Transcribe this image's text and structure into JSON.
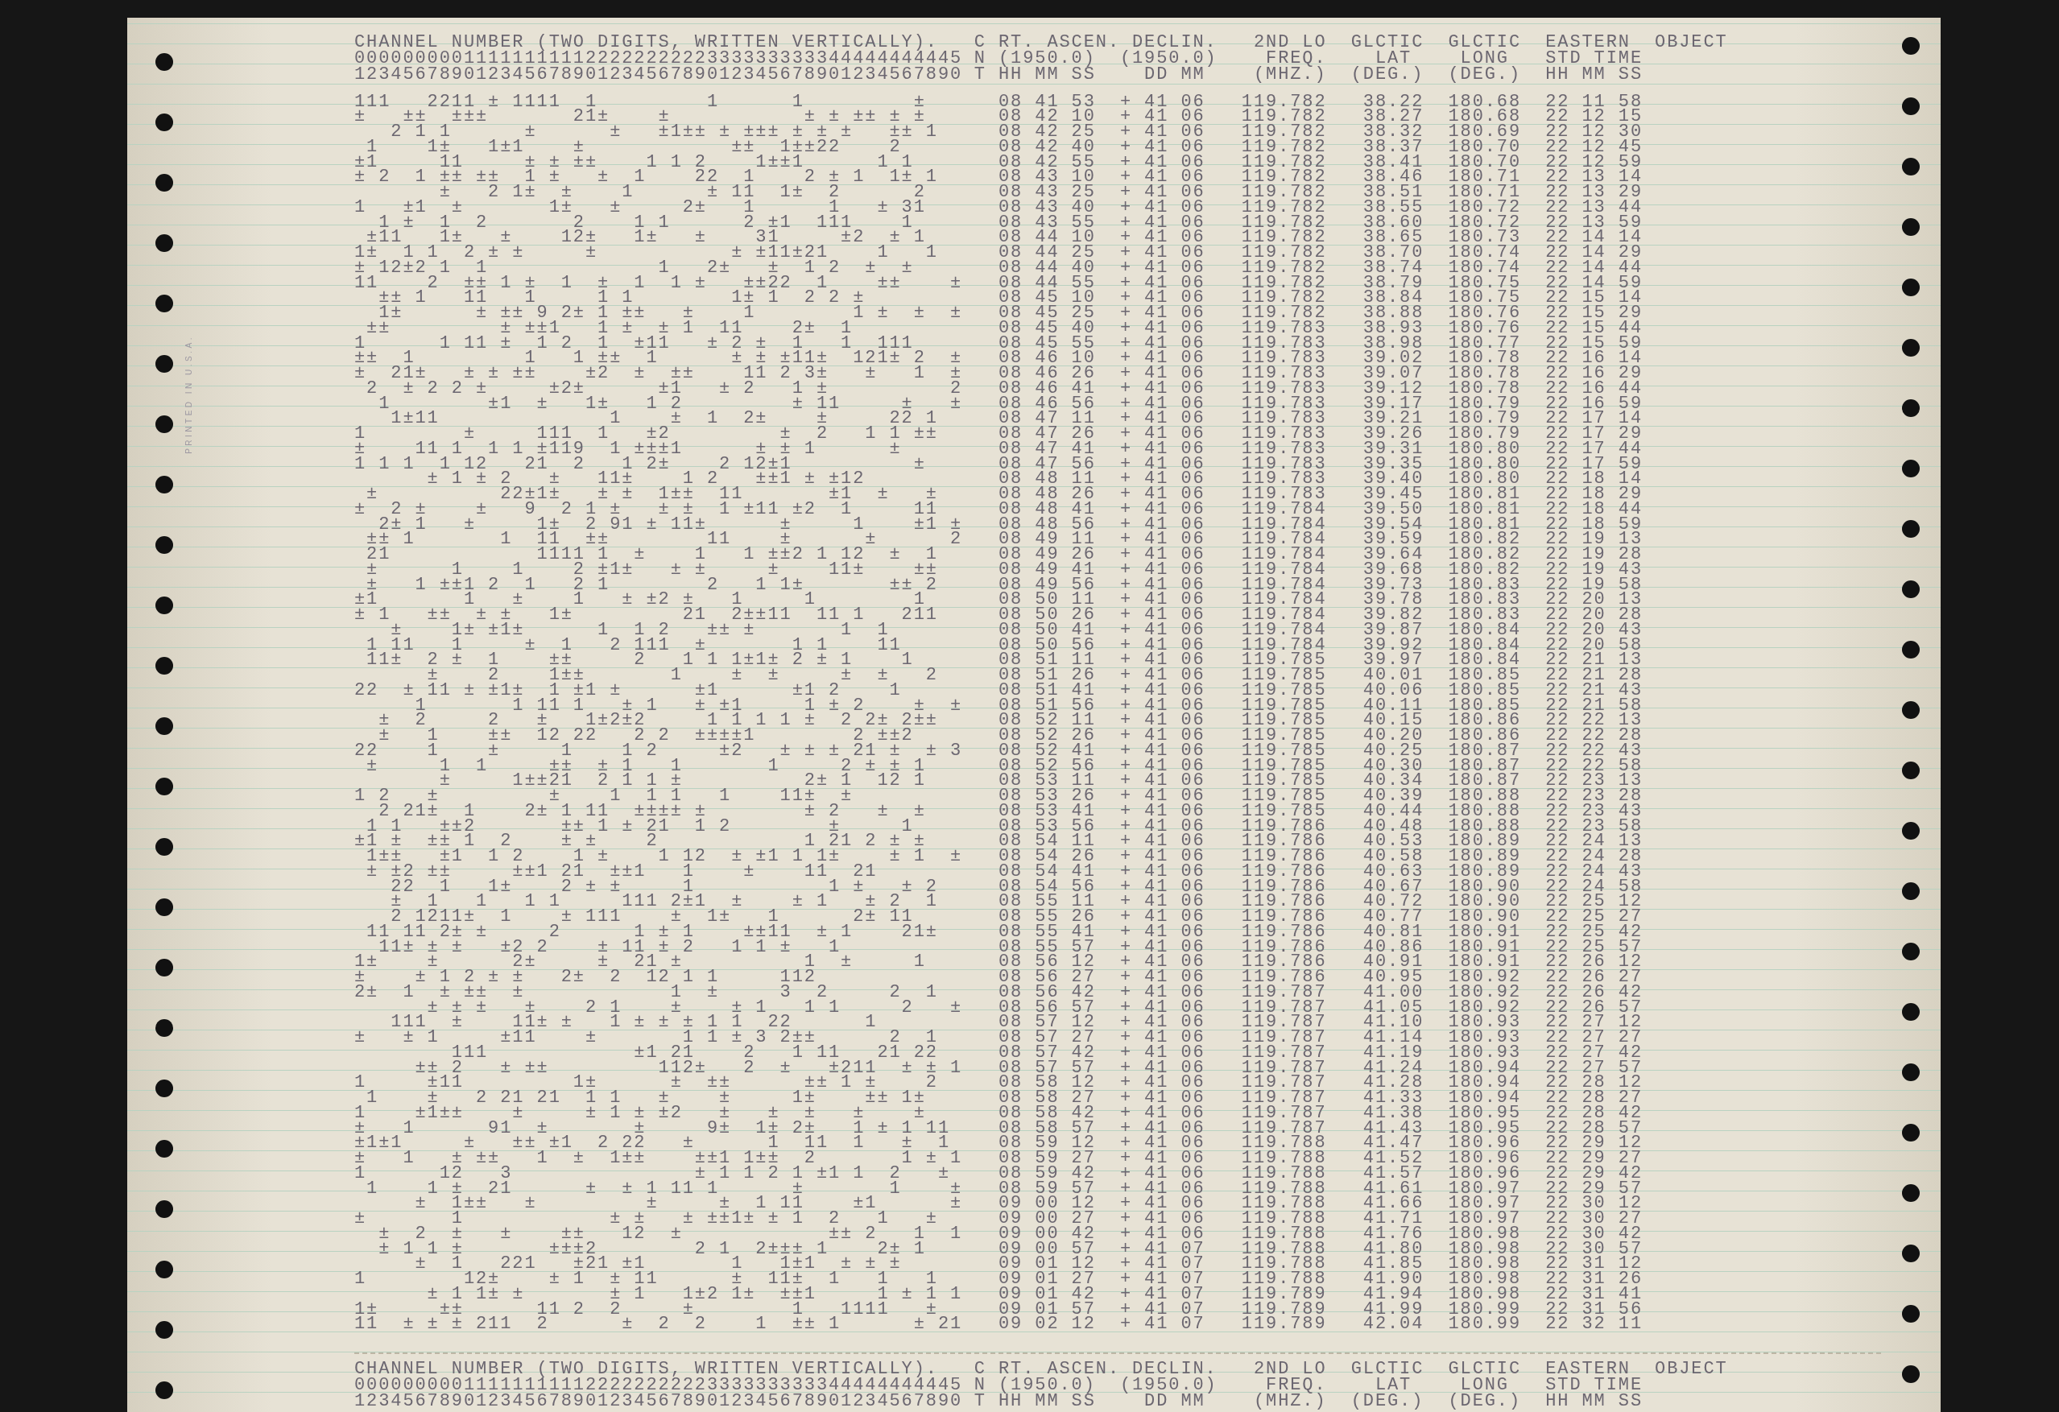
{
  "printout": {
    "margin_imprint": "PRINTED IN U.S.A.",
    "header": {
      "channels": [
        "CHANNEL NUMBER (TWO DIGITS, WRITTEN VERTICALLY).",
        "00000000011111111112222222222333333333344444444445",
        "12345678901234567890123456789012345678901234567890"
      ],
      "flag": [
        "C",
        "N",
        "T"
      ],
      "right_ascension": [
        "RT. ASCEN.",
        "(1950.0)",
        "HH MM SS"
      ],
      "declination": [
        "DECLIN.",
        "(1950.0)",
        "DD MM"
      ],
      "frequency": [
        "2ND LO",
        "FREQ.",
        "(MHZ.)"
      ],
      "galactic_lat": [
        "GLCTIC",
        "LAT",
        "(DEG.)"
      ],
      "galactic_long": [
        "GLCTIC",
        "LONG",
        "(DEG.)"
      ],
      "time": [
        "EASTERN",
        "STD TIME",
        "HH MM SS"
      ],
      "object": [
        "OBJECT"
      ]
    },
    "rows": [
      {
        "channels": "111   2211 ± 1111  1         1      1         ±",
        "right_ascension": "08 41 53",
        "declination": "+ 41 06",
        "frequency": "119.782",
        "galactic_lat": "38.22",
        "galactic_long": "180.68",
        "time": "22 11 58"
      },
      {
        "channels": "±   ±±  ±±±       21±    ±           ± ± ±± ± ±",
        "right_ascension": "08 42 10",
        "declination": "+ 41 06",
        "frequency": "119.782",
        "galactic_lat": "38.27",
        "galactic_long": "180.68",
        "time": "22 12 15"
      },
      {
        "channels": "   2 1 1      ±      ±   ±1±± ± ±±± ± ± ±   ±± 1",
        "right_ascension": "08 42 25",
        "declination": "+ 41 06",
        "frequency": "119.782",
        "galactic_lat": "38.32",
        "galactic_long": "180.69",
        "time": "22 12 30"
      },
      {
        "channels": " 1    1±   1±1    ±            ±±  1±±22    2",
        "right_ascension": "08 42 40",
        "declination": "+ 41 06",
        "frequency": "119.782",
        "galactic_lat": "38.37",
        "galactic_long": "180.70",
        "time": "22 12 45"
      },
      {
        "channels": "±1     11     ± ± ±±    1 1 2    1±±1      1 1",
        "right_ascension": "08 42 55",
        "declination": "+ 41 06",
        "frequency": "119.782",
        "galactic_lat": "38.41",
        "galactic_long": "180.70",
        "time": "22 12 59"
      },
      {
        "channels": "± 2  1 ±± ±±  1 ±   ±  1    22  1    2 ± 1  1± 1",
        "right_ascension": "08 43 10",
        "declination": "+ 41 06",
        "frequency": "119.782",
        "galactic_lat": "38.46",
        "galactic_long": "180.71",
        "time": "22 13 14"
      },
      {
        "channels": "       ±   2 1±  ±    1      ± 11  1±  2      2",
        "right_ascension": "08 43 25",
        "declination": "+ 41 06",
        "frequency": "119.782",
        "galactic_lat": "38.51",
        "galactic_long": "180.71",
        "time": "22 13 29"
      },
      {
        "channels": "1   ±1  ±       1±   ±     2±   1      1   ± 31",
        "right_ascension": "08 43 40",
        "declination": "+ 41 06",
        "frequency": "119.782",
        "galactic_lat": "38.55",
        "galactic_long": "180.72",
        "time": "22 13 44"
      },
      {
        "channels": "  1 ±  1  2       2    1 1      2 ±1  111    1",
        "right_ascension": "08 43 55",
        "declination": "+ 41 06",
        "frequency": "119.782",
        "galactic_lat": "38.60",
        "galactic_long": "180.72",
        "time": "22 13 59"
      },
      {
        "channels": " ±11   1±   ±    12±   1±   ±    31     ±2  ± 1",
        "right_ascension": "08 44 10",
        "declination": "+ 41 06",
        "frequency": "119.782",
        "galactic_lat": "38.65",
        "galactic_long": "180.73",
        "time": "22 14 14"
      },
      {
        "channels": "1±  1 1  2 ± ±     ±           ± ±11±21    1   1",
        "right_ascension": "08 44 25",
        "declination": "+ 41 06",
        "frequency": "119.782",
        "galactic_lat": "38.70",
        "galactic_long": "180.74",
        "time": "22 14 29"
      },
      {
        "channels": "± 12±2 1  1              1   2±   ±  1 2  ±  ±",
        "right_ascension": "08 44 40",
        "declination": "+ 41 06",
        "frequency": "119.782",
        "galactic_lat": "38.74",
        "galactic_long": "180.74",
        "time": "22 14 44"
      },
      {
        "channels": "11    2  ±± 1 ±  1  ±  1  1 ±   ±±22  1    ±±    ±",
        "right_ascension": "08 44 55",
        "declination": "+ 41 06",
        "frequency": "119.782",
        "galactic_lat": "38.79",
        "galactic_long": "180.75",
        "time": "22 14 59"
      },
      {
        "channels": "  ±± 1   11   1     1 1        1± 1  2 2 ±",
        "right_ascension": "08 45 10",
        "declination": "+ 41 06",
        "frequency": "119.782",
        "galactic_lat": "38.84",
        "galactic_long": "180.75",
        "time": "22 15 14"
      },
      {
        "channels": "  1±      ± ±± 9 2± 1 ±±   ±    1        1 ±  ±  ±",
        "right_ascension": "08 45 25",
        "declination": "+ 41 06",
        "frequency": "119.782",
        "galactic_lat": "38.88",
        "galactic_long": "180.76",
        "time": "22 15 29"
      },
      {
        "channels": " ±±         ± ±±1   1 ±  ± 1  11    2±  1",
        "right_ascension": "08 45 40",
        "declination": "+ 41 06",
        "frequency": "119.783",
        "galactic_lat": "38.93",
        "galactic_long": "180.76",
        "time": "22 15 44"
      },
      {
        "channels": "1      1 11 ±  1 2  1  ±11   ± 2 ±  1   1  111",
        "right_ascension": "08 45 55",
        "declination": "+ 41 06",
        "frequency": "119.783",
        "galactic_lat": "38.98",
        "galactic_long": "180.77",
        "time": "22 15 59"
      },
      {
        "channels": "±±  1         1   1 ±±  1      ± ± ±11±  121± 2  ±",
        "right_ascension": "08 46 10",
        "declination": "+ 41 06",
        "frequency": "119.783",
        "galactic_lat": "39.02",
        "galactic_long": "180.78",
        "time": "22 16 14"
      },
      {
        "channels": "±  21±   ± ± ±±    ±2  ±  ±±    11 2 3±   ±   1  ±",
        "right_ascension": "08 46 26",
        "declination": "+ 41 06",
        "frequency": "119.783",
        "galactic_lat": "39.07",
        "galactic_long": "180.78",
        "time": "22 16 29"
      },
      {
        "channels": " 2  ± 2 2 ±     ±2±      ±1   ± 2   1 ±          2",
        "right_ascension": "08 46 41",
        "declination": "+ 41 06",
        "frequency": "119.783",
        "galactic_lat": "39.12",
        "galactic_long": "180.78",
        "time": "22 16 44"
      },
      {
        "channels": "  1        ±1  ±   1±   1 2         ± 11     ±   ±",
        "right_ascension": "08 46 56",
        "declination": "+ 41 06",
        "frequency": "119.783",
        "galactic_lat": "39.17",
        "galactic_long": "180.79",
        "time": "22 16 59"
      },
      {
        "channels": "   1±11              1    ±  1  2±    ±     22 1",
        "right_ascension": "08 47 11",
        "declination": "+ 41 06",
        "frequency": "119.783",
        "galactic_lat": "39.21",
        "galactic_long": "180.79",
        "time": "22 17 14"
      },
      {
        "channels": "1        ±     111  1   ±2         ±  2   1 1 ±±",
        "right_ascension": "08 47 26",
        "declination": "+ 41 06",
        "frequency": "119.783",
        "galactic_lat": "39.26",
        "galactic_long": "180.79",
        "time": "22 17 29"
      },
      {
        "channels": "±    11 1  1 1 ±119  1 ±±±1      ± ± 1      ±",
        "right_ascension": "08 47 41",
        "declination": "+ 41 06",
        "frequency": "119.783",
        "galactic_lat": "39.31",
        "galactic_long": "180.80",
        "time": "22 17 44"
      },
      {
        "channels": "1 1 1  1 12   21  2   1 2±    2 12±1          ±",
        "right_ascension": "08 47 56",
        "declination": "+ 41 06",
        "frequency": "119.783",
        "galactic_lat": "39.35",
        "galactic_long": "180.80",
        "time": "22 17 59"
      },
      {
        "channels": "      ± 1 ± 2   ±   11±    1 2   ±±1 ± ±12",
        "right_ascension": "08 48 11",
        "declination": "+ 41 06",
        "frequency": "119.783",
        "galactic_lat": "39.40",
        "galactic_long": "180.80",
        "time": "22 18 14"
      },
      {
        "channels": " ±          22±1±   ± ±  1±±  11       ±1  ±   ±",
        "right_ascension": "08 48 26",
        "declination": "+ 41 06",
        "frequency": "119.783",
        "galactic_lat": "39.45",
        "galactic_long": "180.81",
        "time": "22 18 29"
      },
      {
        "channels": "±  2 ±    ±   9  2 1 ±   ± ±  1 ±11 ±2  1     11",
        "right_ascension": "08 48 41",
        "declination": "+ 41 06",
        "frequency": "119.784",
        "galactic_lat": "39.50",
        "galactic_long": "180.81",
        "time": "22 18 44"
      },
      {
        "channels": "  2± 1   ±     1±  2 91 ± 11±      ±     1    ±1 ±",
        "right_ascension": "08 48 56",
        "declination": "+ 41 06",
        "frequency": "119.784",
        "galactic_lat": "39.54",
        "galactic_long": "180.81",
        "time": "22 18 59"
      },
      {
        "channels": " ±± 1       1  11  ±±        11    ±      ±      2",
        "right_ascension": "08 49 11",
        "declination": "+ 41 06",
        "frequency": "119.784",
        "galactic_lat": "39.59",
        "galactic_long": "180.82",
        "time": "22 19 13"
      },
      {
        "channels": " 21            1111 1  ±    1   1 ±±2 1 12  ±  1",
        "right_ascension": "08 49 26",
        "declination": "+ 41 06",
        "frequency": "119.784",
        "galactic_lat": "39.64",
        "galactic_long": "180.82",
        "time": "22 19 28"
      },
      {
        "channels": " ±      1    1    2 ±1±   ± ±     ±    11±    ±±",
        "right_ascension": "08 49 41",
        "declination": "+ 41 06",
        "frequency": "119.784",
        "galactic_lat": "39.68",
        "galactic_long": "180.82",
        "time": "22 19 43"
      },
      {
        "channels": " ±   1 ±±1 2  1   2 1        2   1 1±       ±± 2",
        "right_ascension": "08 49 56",
        "declination": "+ 41 06",
        "frequency": "119.784",
        "galactic_lat": "39.73",
        "galactic_long": "180.83",
        "time": "22 19 58"
      },
      {
        "channels": "±1       1   ±    1   ± ±2 ±   1     1        1",
        "right_ascension": "08 50 11",
        "declination": "+ 41 06",
        "frequency": "119.784",
        "galactic_lat": "39.78",
        "galactic_long": "180.83",
        "time": "22 20 13"
      },
      {
        "channels": "± 1   ±±  ± ±   1±         21  2±±11  11 1   211",
        "right_ascension": "08 50 26",
        "declination": "+ 41 06",
        "frequency": "119.784",
        "galactic_lat": "39.82",
        "galactic_long": "180.83",
        "time": "22 20 28"
      },
      {
        "channels": "   ±    1± ±1±      1  1 2   ±± ±       1  1",
        "right_ascension": "08 50 41",
        "declination": "+ 41 06",
        "frequency": "119.784",
        "galactic_lat": "39.87",
        "galactic_long": "180.84",
        "time": "22 20 43"
      },
      {
        "channels": " 1 11   1     ±  1   2 111  ±       1 1    11",
        "right_ascension": "08 50 56",
        "declination": "+ 41 06",
        "frequency": "119.784",
        "galactic_lat": "39.92",
        "galactic_long": "180.84",
        "time": "22 20 58"
      },
      {
        "channels": " 11±  2 ±  1    ±±     2   1 1 1±1± 2 ± 1    1",
        "right_ascension": "08 51 11",
        "declination": "+ 41 06",
        "frequency": "119.785",
        "galactic_lat": "39.97",
        "galactic_long": "180.84",
        "time": "22 21 13"
      },
      {
        "channels": "      ±    2    1±±       1    ±  ±     ±  ±   2",
        "right_ascension": "08 51 26",
        "declination": "+ 41 06",
        "frequency": "119.785",
        "galactic_lat": "40.01",
        "galactic_long": "180.85",
        "time": "22 21 28"
      },
      {
        "channels": "22  ± 11 ± ±1±  1 ±1 ±      ±1      ±1 2    1",
        "right_ascension": "08 51 41",
        "declination": "+ 41 06",
        "frequency": "119.785",
        "galactic_lat": "40.06",
        "galactic_long": "180.85",
        "time": "22 21 43"
      },
      {
        "channels": "     1       1 11 1   ± 1   ± ±1     1 ± 2    ±  ±",
        "right_ascension": "08 51 56",
        "declination": "+ 41 06",
        "frequency": "119.785",
        "galactic_lat": "40.11",
        "galactic_long": "180.85",
        "time": "22 21 58"
      },
      {
        "channels": "  ±  2     2   ±   1±2±2     1 1 1 1 ±  2 2± 2±±",
        "right_ascension": "08 52 11",
        "declination": "+ 41 06",
        "frequency": "119.785",
        "galactic_lat": "40.15",
        "galactic_long": "180.86",
        "time": "22 22 13"
      },
      {
        "channels": "  ±   1    ±±  12 22   2 2  ±±±±1        2 ±±2",
        "right_ascension": "08 52 26",
        "declination": "+ 41 06",
        "frequency": "119.785",
        "galactic_lat": "40.20",
        "galactic_long": "180.86",
        "time": "22 22 28"
      },
      {
        "channels": "22    1    ±     1    1 2     ±2   ± ± ± 21 ±  ± 3",
        "right_ascension": "08 52 41",
        "declination": "+ 41 06",
        "frequency": "119.785",
        "galactic_lat": "40.25",
        "galactic_long": "180.87",
        "time": "22 22 43"
      },
      {
        "channels": " ±     1  1     ±±  ± 1   1       1     2 ± ± 1",
        "right_ascension": "08 52 56",
        "declination": "+ 41 06",
        "frequency": "119.785",
        "galactic_lat": "40.30",
        "galactic_long": "180.87",
        "time": "22 22 58"
      },
      {
        "channels": "       ±     1±±21  2 1 1 ±          2± 1  12 1",
        "right_ascension": "08 53 11",
        "declination": "+ 41 06",
        "frequency": "119.785",
        "galactic_lat": "40.34",
        "galactic_long": "180.87",
        "time": "22 23 13"
      },
      {
        "channels": "1 2   ±         ±    1  1 1   1    11±  ±",
        "right_ascension": "08 53 26",
        "declination": "+ 41 06",
        "frequency": "119.785",
        "galactic_lat": "40.39",
        "galactic_long": "180.88",
        "time": "22 23 28"
      },
      {
        "channels": "  2 21±  1    2± 1 11  ±±±± ±        ± 2   ±  ±",
        "right_ascension": "08 53 41",
        "declination": "+ 41 06",
        "frequency": "119.785",
        "galactic_lat": "40.44",
        "galactic_long": "180.88",
        "time": "22 23 43"
      },
      {
        "channels": " 1 1   ±±2       ±± 1 ± 21  1 2        ±     1",
        "right_ascension": "08 53 56",
        "declination": "+ 41 06",
        "frequency": "119.786",
        "galactic_lat": "40.48",
        "galactic_long": "180.88",
        "time": "22 23 58"
      },
      {
        "channels": "±1 ±  ±± 1  2    ± ±    2            1 21 2 ± ±",
        "right_ascension": "08 54 11",
        "declination": "+ 41 06",
        "frequency": "119.786",
        "galactic_lat": "40.53",
        "galactic_long": "180.89",
        "time": "22 24 13"
      },
      {
        "channels": " 1±±   ±1  1 2    1 ±    1 12  ± ±1 1 1±    ± 1  ±",
        "right_ascension": "08 54 26",
        "declination": "+ 41 06",
        "frequency": "119.786",
        "galactic_lat": "40.58",
        "galactic_long": "180.89",
        "time": "22 24 28"
      },
      {
        "channels": " ± ±2 ±±     ±±1 21  ±±1   1    ±    11  21",
        "right_ascension": "08 54 41",
        "declination": "+ 41 06",
        "frequency": "119.786",
        "galactic_lat": "40.63",
        "galactic_long": "180.89",
        "time": "22 24 43"
      },
      {
        "channels": "   22  1   1±    2 ± ±     1           1 ±   ± 2",
        "right_ascension": "08 54 56",
        "declination": "+ 41 06",
        "frequency": "119.786",
        "galactic_lat": "40.67",
        "galactic_long": "180.90",
        "time": "22 24 58"
      },
      {
        "channels": "   ±  1   1   1 1     111 2±1  ±    ± 1   ± 2  1",
        "right_ascension": "08 55 11",
        "declination": "+ 41 06",
        "frequency": "119.786",
        "galactic_lat": "40.72",
        "galactic_long": "180.90",
        "time": "22 25 12"
      },
      {
        "channels": "   2 1211±  1    ± 111    ±  1±   1      2± 11",
        "right_ascension": "08 55 26",
        "declination": "+ 41 06",
        "frequency": "119.786",
        "galactic_lat": "40.77",
        "galactic_long": "180.90",
        "time": "22 25 27"
      },
      {
        "channels": " 11 11 2± ±     2      1 ± 1    ±±11  ± 1    21±",
        "right_ascension": "08 55 41",
        "declination": "+ 41 06",
        "frequency": "119.786",
        "galactic_lat": "40.81",
        "galactic_long": "180.91",
        "time": "22 25 42"
      },
      {
        "channels": "  11± ± ±   ±2 2    ± 11 ± 2   1 1 ±   1",
        "right_ascension": "08 55 57",
        "declination": "+ 41 06",
        "frequency": "119.786",
        "galactic_lat": "40.86",
        "galactic_long": "180.91",
        "time": "22 25 57"
      },
      {
        "channels": "1±    ±      2±     ±  21 ±          1  ±     1",
        "right_ascension": "08 56 12",
        "declination": "+ 41 06",
        "frequency": "119.786",
        "galactic_lat": "40.91",
        "galactic_long": "180.91",
        "time": "22 26 12"
      },
      {
        "channels": "±    ± 1 2 ± ±   2±  2  12 1 1     112",
        "right_ascension": "08 56 27",
        "declination": "+ 41 06",
        "frequency": "119.786",
        "galactic_lat": "40.95",
        "galactic_long": "180.92",
        "time": "22 26 27"
      },
      {
        "channels": "2±  1  ± ±±  ±            1  ±     3  2     2  1",
        "right_ascension": "08 56 42",
        "declination": "+ 41 06",
        "frequency": "119.787",
        "galactic_lat": "41.00",
        "galactic_long": "180.92",
        "time": "22 26 42"
      },
      {
        "channels": "      ± ± ±   ±    2 1    ±    ± 1   1 1     2   ±",
        "right_ascension": "08 56 57",
        "declination": "+ 41 06",
        "frequency": "119.787",
        "galactic_lat": "41.05",
        "galactic_long": "180.92",
        "time": "22 26 57"
      },
      {
        "channels": "   111  ±    11± ±   1 ± ± ± 1 1  22      1",
        "right_ascension": "08 57 12",
        "declination": "+ 41 06",
        "frequency": "119.787",
        "galactic_lat": "41.10",
        "galactic_long": "180.93",
        "time": "22 27 12"
      },
      {
        "channels": "±   ± 1     ±11    ±       1 1 ± 3 2±±      2  1",
        "right_ascension": "08 57 27",
        "declination": "+ 41 06",
        "frequency": "119.787",
        "galactic_lat": "41.14",
        "galactic_long": "180.93",
        "time": "22 27 27"
      },
      {
        "channels": "        111            ±1 21    2   1 11   21 22",
        "right_ascension": "08 57 42",
        "declination": "+ 41 06",
        "frequency": "119.787",
        "galactic_lat": "41.19",
        "galactic_long": "180.93",
        "time": "22 27 42"
      },
      {
        "channels": "     ±± 2   ± ±±         112±   2  ±   ±211  ± ± 1",
        "right_ascension": "08 57 57",
        "declination": "+ 41 06",
        "frequency": "119.787",
        "galactic_lat": "41.24",
        "galactic_long": "180.94",
        "time": "22 27 57"
      },
      {
        "channels": "1     ±11         1±      ±  ±±      ±± 1 ±    2",
        "right_ascension": "08 58 12",
        "declination": "+ 41 06",
        "frequency": "119.787",
        "galactic_lat": "41.28",
        "galactic_long": "180.94",
        "time": "22 28 12"
      },
      {
        "channels": " 1    ±   2 21 21  1 1   ±    ±     1±    ±± 1±",
        "right_ascension": "08 58 27",
        "declination": "+ 41 06",
        "frequency": "119.787",
        "galactic_lat": "41.33",
        "galactic_long": "180.94",
        "time": "22 28 27"
      },
      {
        "channels": "1    ±1±±    ±     ± 1 ± ±2   ±   ±  ±   ±    ±",
        "right_ascension": "08 58 42",
        "declination": "+ 41 06",
        "frequency": "119.787",
        "galactic_lat": "41.38",
        "galactic_long": "180.95",
        "time": "22 28 42"
      },
      {
        "channels": "±   1      91  ±       ±     9±  1± 2±   1 ± 1 11",
        "right_ascension": "08 58 57",
        "declination": "+ 41 06",
        "frequency": "119.787",
        "galactic_lat": "41.43",
        "galactic_long": "180.95",
        "time": "22 28 57"
      },
      {
        "channels": "±1±1     ±   ±± ±1  2 22   ±      1  11  1   ±  1",
        "right_ascension": "08 59 12",
        "declination": "+ 41 06",
        "frequency": "119.788",
        "galactic_lat": "41.47",
        "galactic_long": "180.96",
        "time": "22 29 12"
      },
      {
        "channels": "±   1   ± ±±   1  ±  1±±    ±±1 1±±  2       1 ± 1",
        "right_ascension": "08 59 27",
        "declination": "+ 41 06",
        "frequency": "119.788",
        "galactic_lat": "41.52",
        "galactic_long": "180.96",
        "time": "22 29 27"
      },
      {
        "channels": "1      12   3               ± 1 1 2 1 ±1 1  2   ±",
        "right_ascension": "08 59 42",
        "declination": "+ 41 06",
        "frequency": "119.788",
        "galactic_lat": "41.57",
        "galactic_long": "180.96",
        "time": "22 29 42"
      },
      {
        "channels": " 1    1 ±  21      ±  ± 1 11 1      ±       1    ±",
        "right_ascension": "08 59 57",
        "declination": "+ 41 06",
        "frequency": "119.788",
        "galactic_lat": "41.61",
        "galactic_long": "180.97",
        "time": "22 29 57"
      },
      {
        "channels": "     ±  1±±   ±         ±     ±  1 11    ±1      ±",
        "right_ascension": "09 00 12",
        "declination": "+ 41 06",
        "frequency": "119.788",
        "galactic_lat": "41.66",
        "galactic_long": "180.97",
        "time": "22 30 12"
      },
      {
        "channels": "±       1            ± ±   ± ±±1± ± 1  2   1   ±",
        "right_ascension": "09 00 27",
        "declination": "+ 41 06",
        "frequency": "119.788",
        "galactic_lat": "41.71",
        "galactic_long": "180.97",
        "time": "22 30 27"
      },
      {
        "channels": "  ±  2  ±   ±    ±±   12  ±            ±± 2   1  1",
        "right_ascension": "09 00 42",
        "declination": "+ 41 06",
        "frequency": "119.788",
        "galactic_lat": "41.76",
        "galactic_long": "180.98",
        "time": "22 30 42"
      },
      {
        "channels": "  ± 1 1 ±       ±±±2        2 1  2±±± 1    2± 1",
        "right_ascension": "09 00 57",
        "declination": "+ 41 07",
        "frequency": "119.788",
        "galactic_lat": "41.80",
        "galactic_long": "180.98",
        "time": "22 30 57"
      },
      {
        "channels": "     ±  1   221   ±21 ±1       1   1±1  ± ± ±",
        "right_ascension": "09 01 12",
        "declination": "+ 41 07",
        "frequency": "119.788",
        "galactic_lat": "41.85",
        "galactic_long": "180.98",
        "time": "22 31 12"
      },
      {
        "channels": "1        12±    ± 1  ± 11      ±  11±  1   1   1",
        "right_ascension": "09 01 27",
        "declination": "+ 41 07",
        "frequency": "119.788",
        "galactic_lat": "41.90",
        "galactic_long": "180.98",
        "time": "22 31 26"
      },
      {
        "channels": "      ± 1 1± ±       ± 1   1±2 1±  ±±1     1 ± 1 1",
        "right_ascension": "09 01 42",
        "declination": "+ 41 07",
        "frequency": "119.789",
        "galactic_lat": "41.94",
        "galactic_long": "180.98",
        "time": "22 31 41"
      },
      {
        "channels": "1±     ±±      11 2  2     ±        1   1111   ±",
        "right_ascension": "09 01 57",
        "declination": "+ 41 07",
        "frequency": "119.789",
        "galactic_lat": "41.99",
        "galactic_long": "180.99",
        "time": "22 31 56"
      },
      {
        "channels": "11  ± ± ± 211  2      ±  2  2    1  ±± 1      ± 21",
        "right_ascension": "09 02 12",
        "declination": "+ 41 07",
        "frequency": "119.789",
        "galactic_lat": "42.04",
        "galactic_long": "180.99",
        "time": "22 32 11"
      }
    ],
    "next_page_header": {
      "channels": [
        "CHANNEL NUMBER (TWO DIGITS, WRITTEN VERTICALLY).",
        "00000000011111111112222222222333333333344444444445",
        "12345678901234567890123456789012345678901234567890"
      ],
      "flag": [
        "C",
        "N",
        "T"
      ],
      "right_ascension": [
        "RT. ASCEN.",
        "(1950.0)",
        "HH MM SS"
      ],
      "declination": [
        "DECLIN.",
        "(1950.0)",
        "DD MM"
      ],
      "frequency": [
        "2ND LO",
        "FREQ.",
        "(MHZ.)"
      ],
      "galactic_lat": [
        "GLCTIC",
        "LAT",
        "(DEG.)"
      ],
      "galactic_long": [
        "GLCTIC",
        "LONG",
        "(DEG.)"
      ],
      "time": [
        "EASTERN",
        "STD TIME",
        "HH MM SS"
      ],
      "object": [
        "OBJECT"
      ]
    }
  }
}
